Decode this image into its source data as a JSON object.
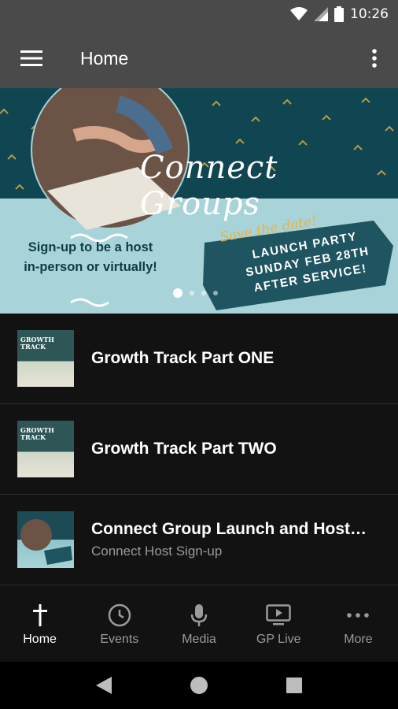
{
  "status_bar": {
    "time": "10:26"
  },
  "app_bar": {
    "title": "Home"
  },
  "banner": {
    "title": "Connect Groups",
    "signup_text": "Sign-up to be a host in-person or virtually!",
    "save_the_date": "Save the date!",
    "launch_text": "LAUNCH PARTY SUNDAY FEB 28TH AFTER SERVICE!",
    "slide_count": 4,
    "active_slide": 1
  },
  "list": {
    "items": [
      {
        "title": "Growth Track Part ONE",
        "subtitle": "",
        "thumb_text": "GROWTH TRACK"
      },
      {
        "title": "Growth Track Part TWO",
        "subtitle": "",
        "thumb_text": "GROWTH TRACK"
      },
      {
        "title": "Connect Group Launch and Host…",
        "subtitle": "Connect Host Sign-up",
        "thumb_text": ""
      }
    ]
  },
  "bottom_nav": {
    "tabs": [
      {
        "label": "Home",
        "icon": "cross-icon",
        "active": true
      },
      {
        "label": "Events",
        "icon": "clock-icon",
        "active": false
      },
      {
        "label": "Media",
        "icon": "microphone-icon",
        "active": false
      },
      {
        "label": "GP Live",
        "icon": "tv-play-icon",
        "active": false
      },
      {
        "label": "More",
        "icon": "more-horizontal-icon",
        "active": false
      }
    ]
  },
  "colors": {
    "app_bar": "#4a4a4a",
    "background": "#121212",
    "banner_teal": "#0f4651",
    "banner_light": "#a8d3d8",
    "accent_gold": "#e7b34a"
  }
}
